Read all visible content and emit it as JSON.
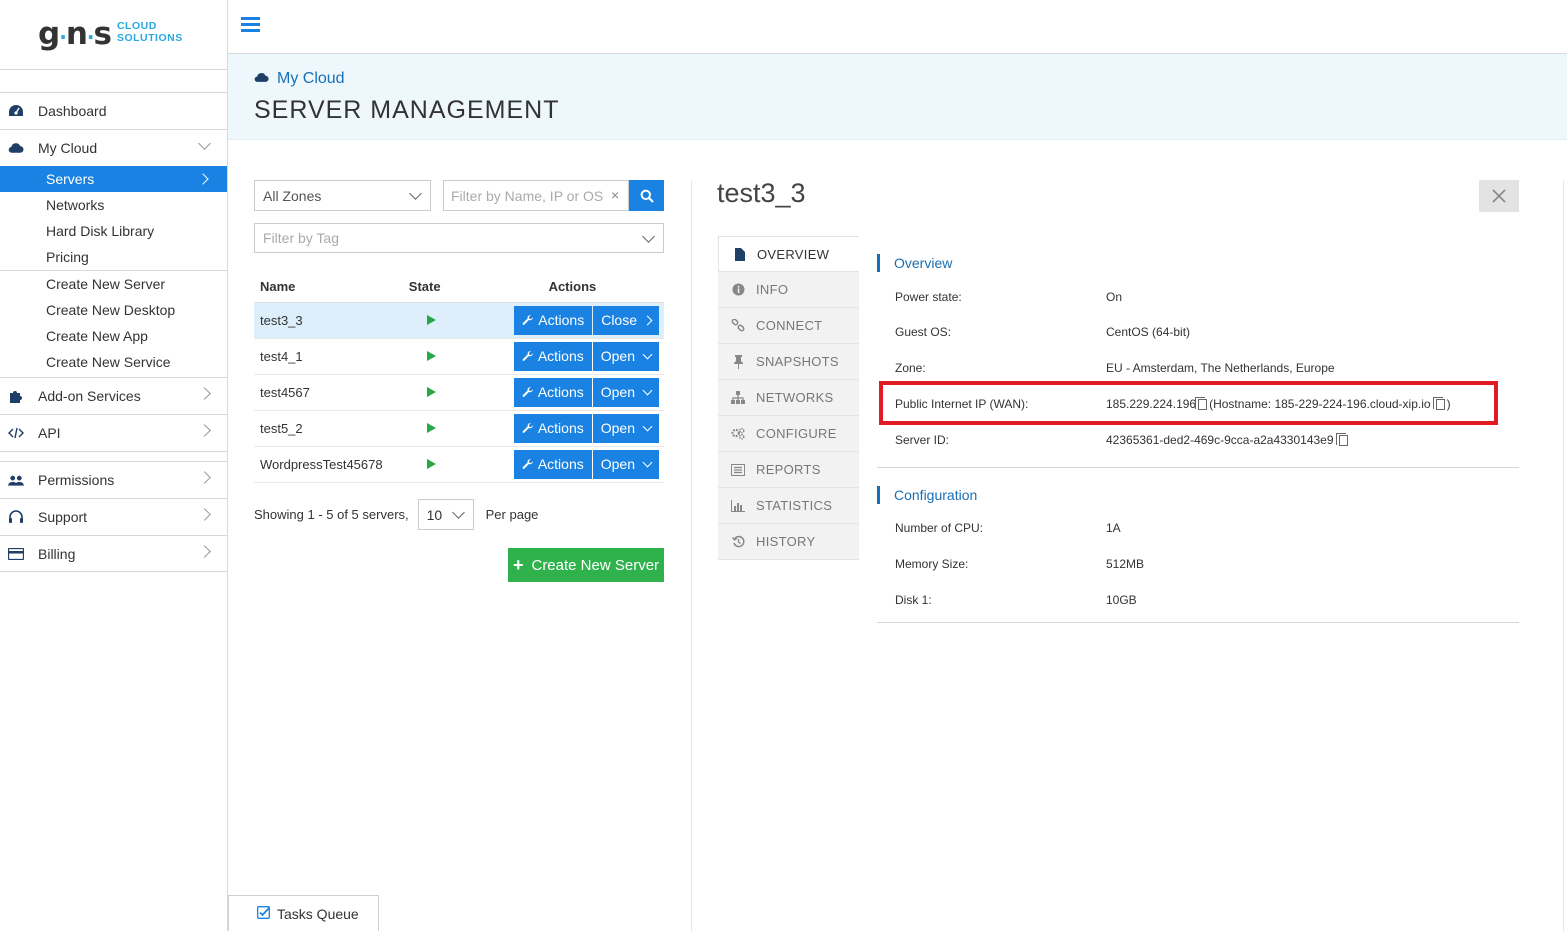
{
  "brand": {
    "mark": "g",
    "mark2": "n",
    "mark3": "s",
    "line1": "CLOUD",
    "line2": "SOLUTIONS"
  },
  "sidebar": {
    "items": [
      {
        "label": "Dashboard",
        "icon": "dashboard-icon"
      },
      {
        "label": "My Cloud",
        "icon": "cloud-icon"
      }
    ],
    "mycloud_sub": [
      "Servers",
      "Networks",
      "Hard Disk Library",
      "Pricing"
    ],
    "create_sub": [
      "Create New Server",
      "Create New Desktop",
      "Create New App",
      "Create New Service"
    ],
    "more": [
      {
        "label": "Add-on Services",
        "icon": "puzzle-icon"
      },
      {
        "label": "API",
        "icon": "code-icon"
      }
    ],
    "bottom": [
      {
        "label": "Permissions",
        "icon": "users-icon"
      },
      {
        "label": "Support",
        "icon": "headset-icon"
      },
      {
        "label": "Billing",
        "icon": "credit-card-icon"
      }
    ]
  },
  "header": {
    "breadcrumb": "My Cloud",
    "title": "SERVER MANAGEMENT"
  },
  "filters": {
    "zone": "All Zones",
    "search_placeholder": "Filter by Name, IP or OS",
    "tag_placeholder": "Filter by Tag"
  },
  "table": {
    "headers": {
      "name": "Name",
      "state": "State",
      "actions": "Actions"
    },
    "rows": [
      {
        "name": "test3_3",
        "actions": "Actions",
        "toggle": "Close"
      },
      {
        "name": "test4_1",
        "actions": "Actions",
        "toggle": "Open"
      },
      {
        "name": "test4567",
        "actions": "Actions",
        "toggle": "Open"
      },
      {
        "name": "test5_2",
        "actions": "Actions",
        "toggle": "Open"
      },
      {
        "name": "WordpressTest45678",
        "actions": "Actions",
        "toggle": "Open"
      }
    ]
  },
  "pager": {
    "showing": "Showing 1 - 5 of 5 servers,",
    "per_page_value": "10",
    "per_page_label": "Per page"
  },
  "create_button": "Create New Server",
  "detail": {
    "title": "test3_3",
    "tabs": [
      {
        "label": "OVERVIEW",
        "icon": "document-icon"
      },
      {
        "label": "INFO",
        "icon": "info-icon"
      },
      {
        "label": "CONNECT",
        "icon": "link-icon"
      },
      {
        "label": "SNAPSHOTS",
        "icon": "pin-icon"
      },
      {
        "label": "NETWORKS",
        "icon": "sitemap-icon"
      },
      {
        "label": "CONFIGURE",
        "icon": "gears-icon"
      },
      {
        "label": "REPORTS",
        "icon": "list-icon"
      },
      {
        "label": "STATISTICS",
        "icon": "bar-chart-icon"
      },
      {
        "label": "HISTORY",
        "icon": "history-icon"
      }
    ],
    "overview_title": "Overview",
    "overview": {
      "power_label": "Power state:",
      "power_value": "On",
      "os_label": "Guest OS:",
      "os_value": "CentOS (64-bit)",
      "zone_label": "Zone:",
      "zone_value": "EU - Amsterdam, The Netherlands, Europe",
      "ip_label": "Public Internet IP (WAN):",
      "ip_value": "185.229.224.196",
      "hostname_prefix": "(Hostname: ",
      "hostname_value": "185-229-224-196.cloud-xip.io",
      "hostname_suffix": ")",
      "id_label": "Server ID:",
      "id_value": "42365361-ded2-469c-9cca-a2a4330143e9"
    },
    "config_title": "Configuration",
    "config": {
      "cpu_label": "Number of CPU:",
      "cpu_value": "1A",
      "mem_label": "Memory Size:",
      "mem_value": "512MB",
      "disk_label": "Disk 1:",
      "disk_value": "10GB"
    }
  },
  "tasks_queue": "Tasks Queue",
  "colors": {
    "accent": "#1a82e2",
    "success": "#2fb24c",
    "highlight": "#e01b24",
    "header_bg": "#eef7fc"
  }
}
